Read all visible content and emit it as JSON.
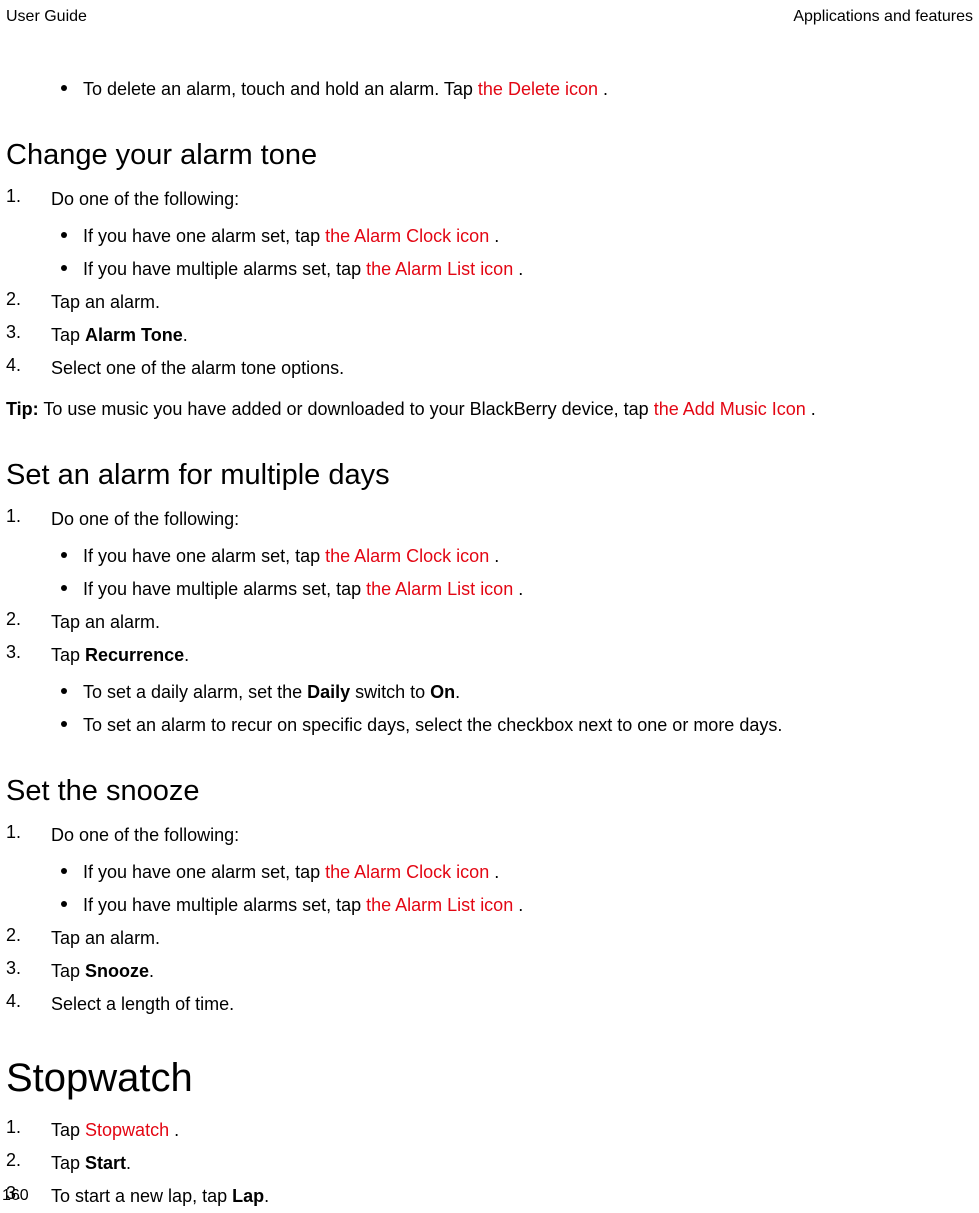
{
  "header": {
    "left": "User Guide",
    "right": "Applications and features"
  },
  "topBullet": {
    "prefix": "To delete an alarm, touch and hold an alarm. Tap  ",
    "link": "the Delete icon",
    "suffix": " ."
  },
  "section1": {
    "title": "Change your alarm tone",
    "step1": "Do one of the following:",
    "sub1a_prefix": "If you have one alarm set, tap  ",
    "sub1a_link": "the Alarm Clock icon",
    "sub1a_suffix": " .",
    "sub1b_prefix": "If you have multiple alarms set, tap  ",
    "sub1b_link": "the Alarm List icon",
    "sub1b_suffix": " .",
    "step2": "Tap an alarm.",
    "step3_pre": "Tap ",
    "step3_bold": "Alarm Tone",
    "step3_post": ".",
    "step4": "Select one of the alarm tone options.",
    "tip_label": "Tip:",
    "tip_body_pre": " To use music you have added or downloaded to your BlackBerry device, tap  ",
    "tip_link": "the Add Music Icon",
    "tip_body_post": " ."
  },
  "section2": {
    "title": "Set an alarm for multiple days",
    "step1": "Do one of the following:",
    "sub1a_prefix": "If you have one alarm set, tap  ",
    "sub1a_link": "the Alarm Clock icon",
    "sub1a_suffix": " .",
    "sub1b_prefix": "If you have multiple alarms set, tap  ",
    "sub1b_link": "the Alarm List icon",
    "sub1b_suffix": " .",
    "step2": "Tap an alarm.",
    "step3_pre": "Tap ",
    "step3_bold": "Recurrence",
    "step3_post": ".",
    "sub3a_pre": "To set a daily alarm, set the ",
    "sub3a_b1": "Daily",
    "sub3a_mid": " switch to ",
    "sub3a_b2": "On",
    "sub3a_post": ".",
    "sub3b": "To set an alarm to recur on specific days, select the checkbox next to one or more days."
  },
  "section3": {
    "title": "Set the snooze",
    "step1": "Do one of the following:",
    "sub1a_prefix": "If you have one alarm set, tap  ",
    "sub1a_link": "the Alarm Clock icon",
    "sub1a_suffix": " .",
    "sub1b_prefix": "If you have multiple alarms set, tap  ",
    "sub1b_link": "the Alarm List icon",
    "sub1b_suffix": " .",
    "step2": "Tap an alarm.",
    "step3_pre": "Tap ",
    "step3_bold": "Snooze",
    "step3_post": ".",
    "step4": "Select a length of time."
  },
  "section4": {
    "title": "Stopwatch",
    "step1_pre": "Tap  ",
    "step1_link": "Stopwatch",
    "step1_post": " .",
    "step2_pre": "Tap ",
    "step2_bold": "Start",
    "step2_post": ".",
    "step3_pre": "To start a new lap, tap ",
    "step3_bold": "Lap",
    "step3_post": "."
  },
  "nums": {
    "n1": "1.",
    "n2": "2.",
    "n3": "3.",
    "n4": "4."
  },
  "pageNumber": "160"
}
